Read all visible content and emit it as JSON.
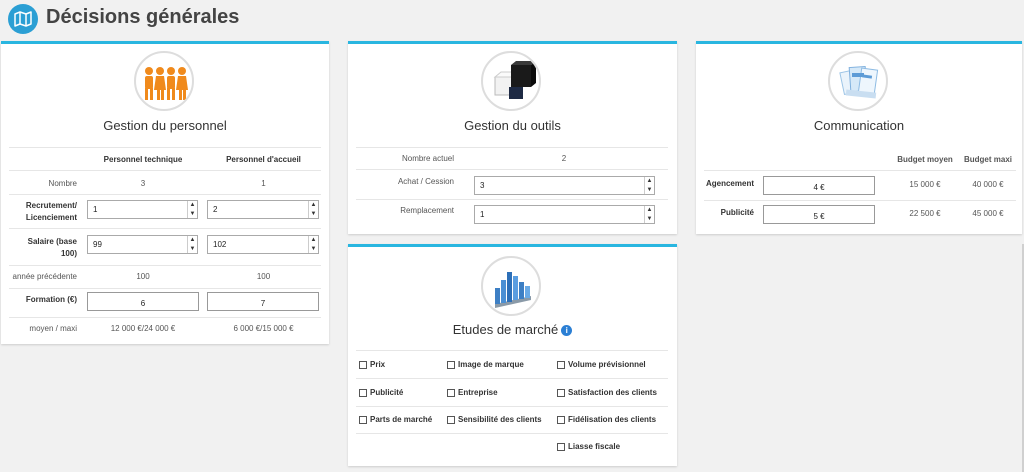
{
  "page": {
    "title": "Décisions générales",
    "icon": "map-icon"
  },
  "personnel": {
    "title": "Gestion du personnel",
    "icon": "people-icon",
    "col1": "Personnel technique",
    "col2": "Personnel d'accueil",
    "rows": {
      "nombre": {
        "label": "Nombre",
        "v1": "3",
        "v2": "1"
      },
      "recrutement": {
        "label1": "Recrutement/",
        "label2": "Licenciement",
        "v1": "1",
        "v2": "2"
      },
      "salaire": {
        "label1": "Salaire (base",
        "label2": "100)",
        "v1": "99",
        "v2": "102"
      },
      "annee": {
        "label": "année précédente",
        "v1": "100",
        "v2": "100"
      },
      "formation": {
        "label": "Formation (€)",
        "v1": "6",
        "v2": "7"
      },
      "moyen": {
        "label": "moyen / maxi",
        "v1": "12 000 €/24 000 €",
        "v2": "6 000 €/15 000 €"
      }
    }
  },
  "outils": {
    "title": "Gestion du outils",
    "icon": "cubes-icon",
    "nombre_label": "Nombre actuel",
    "nombre_value": "2",
    "achat_label": "Achat / Cession",
    "achat_value": "3",
    "remplacement_label": "Remplacement",
    "remplacement_value": "1"
  },
  "communication": {
    "title": "Communication",
    "icon": "brochures-icon",
    "col1": "Budget moyen",
    "col2": "Budget maxi",
    "agencement": {
      "label": "Agencement",
      "value": "4 €",
      "moyen": "15 000 €",
      "maxi": "40 000 €"
    },
    "publicite": {
      "label": "Publicité",
      "value": "5 €",
      "moyen": "22 500 €",
      "maxi": "45 000 €"
    }
  },
  "etudes": {
    "title": "Etudes de marché",
    "icon": "bar-chart-icon",
    "items": {
      "prix": "Prix",
      "image": "Image de marque",
      "volume": "Volume prévisionnel",
      "publicite": "Publicité",
      "entreprise": "Entreprise",
      "satisfaction": "Satisfaction des clients",
      "parts": "Parts de marché",
      "sensibilite": "Sensibilité des clients",
      "fidelisation": "Fidélisation des clients",
      "liasse": "Liasse fiscale"
    }
  },
  "colors": {
    "accent": "#29b6e0",
    "header_icon": "#2b9fd4",
    "background": "#f1f1f1"
  }
}
